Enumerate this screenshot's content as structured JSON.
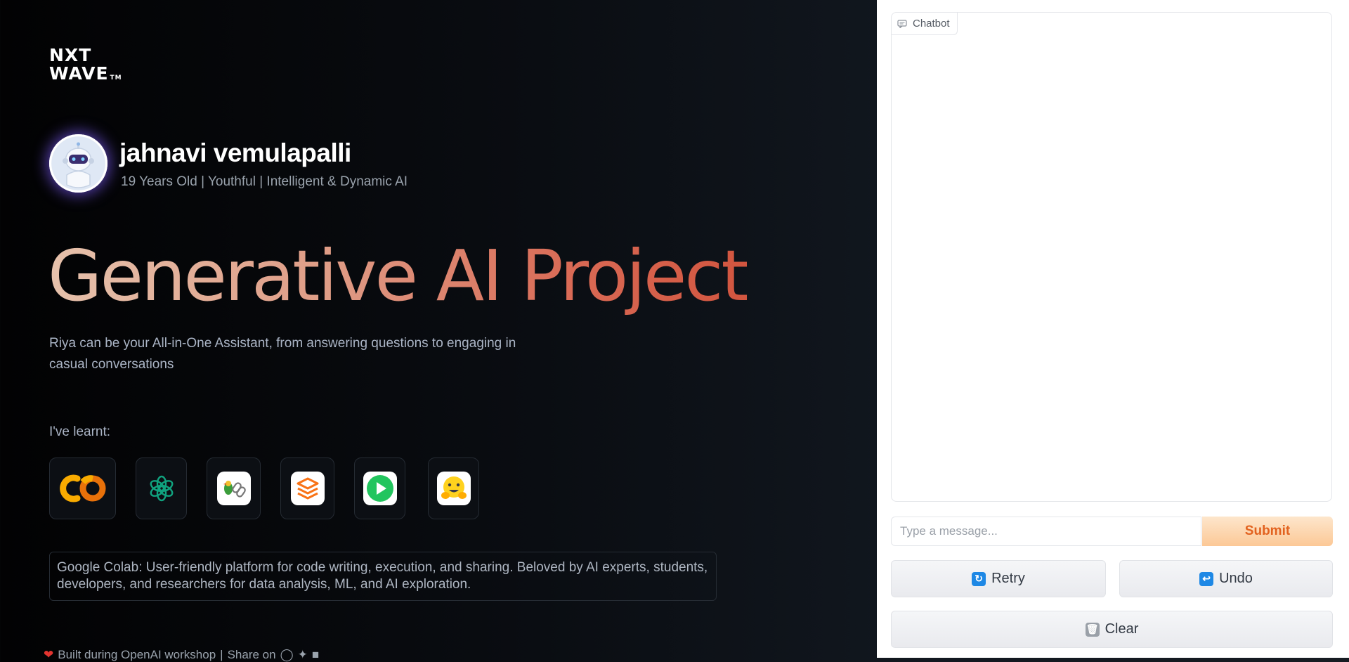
{
  "brand": {
    "line1": "NXT",
    "line2": "WAVE",
    "trademark": "TM"
  },
  "profile": {
    "name": "jahnavi vemulapalli",
    "tagline": "19 Years Old | Youthful | Intelligent & Dynamic AI"
  },
  "hero": {
    "title": "Generative AI Project",
    "description": "Riya can be your All-in-One Assistant, from answering questions to engaging in casual conversations"
  },
  "learnt": {
    "label": "I've learnt:",
    "tools": [
      {
        "icon": "google-colab-icon"
      },
      {
        "icon": "openai-icon"
      },
      {
        "icon": "langchain-icon"
      },
      {
        "icon": "gradio-icon"
      },
      {
        "icon": "play-icon"
      },
      {
        "icon": "hugging-face-icon"
      }
    ],
    "info": "Google Colab: User-friendly platform for code writing, execution, and sharing. Beloved by AI experts, students, developers, and researchers for data analysis, ML, and AI exploration."
  },
  "footer": {
    "built_text": "Built during OpenAI workshop",
    "share_label": "Share on"
  },
  "chat": {
    "label": "Chatbot",
    "input_placeholder": "Type a message...",
    "submit_label": "Submit",
    "retry_label": "Retry",
    "undo_label": "Undo",
    "clear_label": "Clear"
  },
  "colors": {
    "accent": "#e2621f",
    "submit_bg": "#fcc896",
    "title_gradient_start": "#e6c2ac",
    "title_gradient_end": "#d2553f",
    "avatar_glow": "#6e50dc"
  }
}
